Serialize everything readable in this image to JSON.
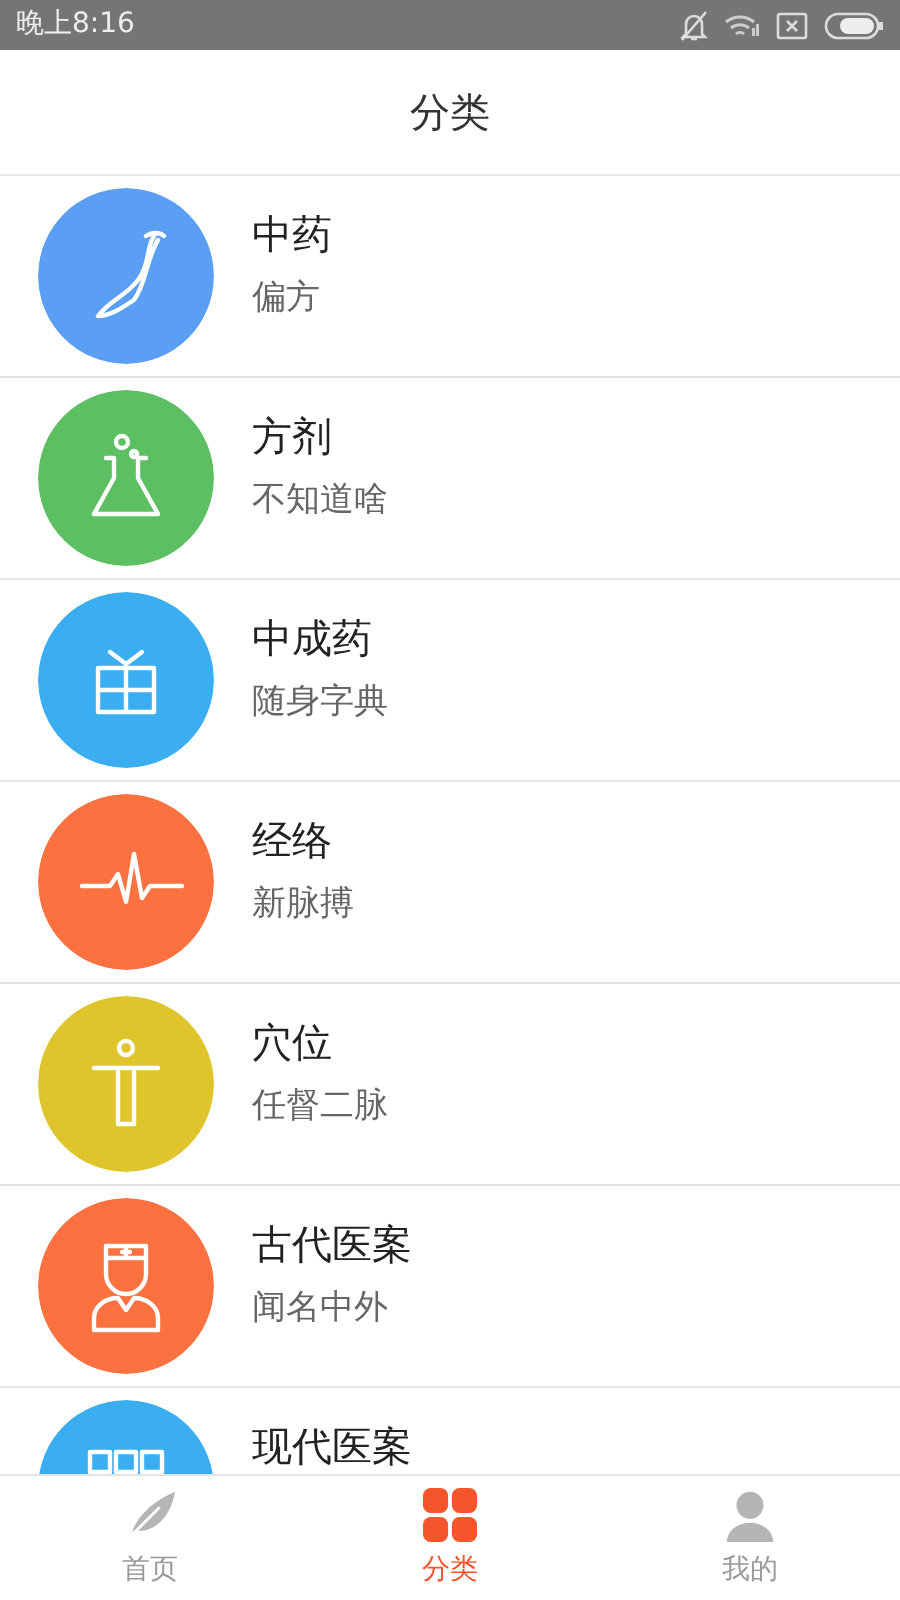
{
  "status_bar": {
    "time": "晚上8:16"
  },
  "header": {
    "title": "分类"
  },
  "categories": [
    {
      "title": "中药",
      "subtitle": "偏方",
      "color": "#5b9ff5"
    },
    {
      "title": "方剂",
      "subtitle": "不知道啥",
      "color": "#5cbf62"
    },
    {
      "title": "中成药",
      "subtitle": "随身字典",
      "color": "#3aaef0"
    },
    {
      "title": "经络",
      "subtitle": "新脉搏",
      "color": "#fb7140"
    },
    {
      "title": "穴位",
      "subtitle": "任督二脉",
      "color": "#e0c42c"
    },
    {
      "title": "古代医案",
      "subtitle": "闻名中外",
      "color": "#fb7140"
    },
    {
      "title": "现代医案",
      "color": "#3aaef0"
    }
  ],
  "tabs": [
    {
      "label": "首页",
      "selected": false
    },
    {
      "label": "分类",
      "selected": true
    },
    {
      "label": "我的",
      "selected": false
    }
  ]
}
